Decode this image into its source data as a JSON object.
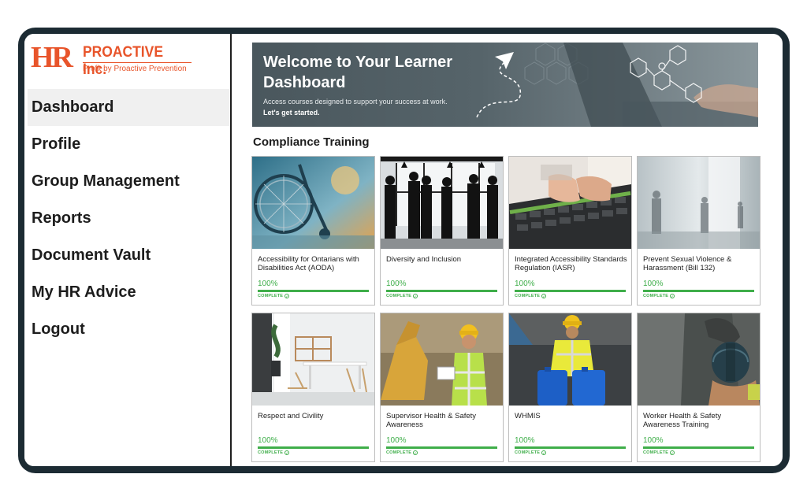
{
  "logo": {
    "mark": "HR",
    "name": "PROACTIVE Inc.",
    "tagline": "Profit by Proactive Prevention"
  },
  "sidebar": {
    "items": [
      {
        "label": "Dashboard",
        "active": true
      },
      {
        "label": "Profile",
        "active": false
      },
      {
        "label": "Group Management",
        "active": false
      },
      {
        "label": "Reports",
        "active": false
      },
      {
        "label": "Document Vault",
        "active": false
      },
      {
        "label": "My HR Advice",
        "active": false
      },
      {
        "label": "Logout",
        "active": false
      }
    ]
  },
  "banner": {
    "title": "Welcome to Your Learner Dashboard",
    "subtitle": "Access courses designed to support your success at work.",
    "cta": "Let's get started."
  },
  "section": {
    "title": "Compliance Training"
  },
  "courses": [
    {
      "title": "Accessibility for Ontarians with Disabilities Act (AODA)",
      "progress_text": "100%",
      "progress": 1.0,
      "status": "COMPLETE",
      "image_icon": "wheelchair-image"
    },
    {
      "title": "Diversity and Inclusion",
      "progress_text": "100%",
      "progress": 1.0,
      "status": "COMPLETE",
      "image_icon": "people-silhouettes-image"
    },
    {
      "title": "Integrated Accessibility Standards Regulation (IASR)",
      "progress_text": "100%",
      "progress": 1.0,
      "status": "COMPLETE",
      "image_icon": "braille-keyboard-image"
    },
    {
      "title": "Prevent Sexual Violence & Harassment (Bill 132)",
      "progress_text": "100%",
      "progress": 1.0,
      "status": "COMPLETE",
      "image_icon": "blurred-office-image"
    },
    {
      "title": "Respect and Civility",
      "progress_text": "100%",
      "progress": 1.0,
      "status": "COMPLETE",
      "image_icon": "office-interior-image"
    },
    {
      "title": "Supervisor Health & Safety Awareness",
      "progress_text": "100%",
      "progress": 1.0,
      "status": "COMPLETE",
      "image_icon": "worker-hardhat-image"
    },
    {
      "title": "WHMIS",
      "progress_text": "100%",
      "progress": 1.0,
      "status": "COMPLETE",
      "image_icon": "chemical-barrels-image"
    },
    {
      "title": "Worker Health & Safety Awareness Training",
      "progress_text": "100%",
      "progress": 1.0,
      "status": "COMPLETE",
      "image_icon": "worker-holding-helmet-image"
    }
  ],
  "colors": {
    "brand": "#e8542a",
    "complete": "#3fae4a",
    "frame": "#1c2b33"
  }
}
